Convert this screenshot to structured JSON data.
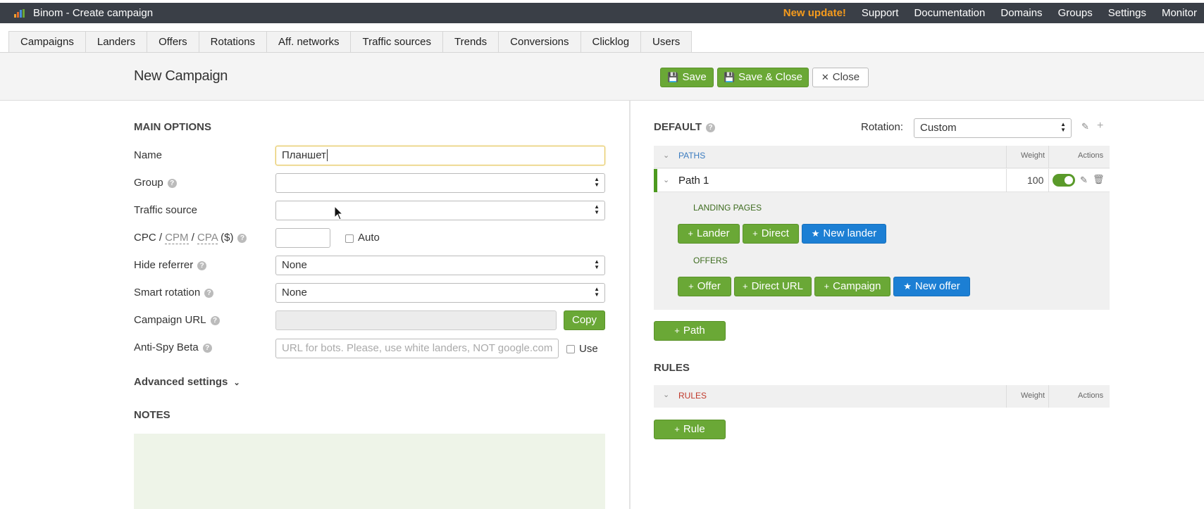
{
  "app": {
    "title": "Binom - Create campaign"
  },
  "topnav": {
    "update": "New update!",
    "items": [
      "Support",
      "Documentation",
      "Domains",
      "Groups",
      "Settings",
      "Monitor"
    ]
  },
  "tabs": [
    "Campaigns",
    "Landers",
    "Offers",
    "Rotations",
    "Aff. networks",
    "Traffic sources",
    "Trends",
    "Conversions",
    "Clicklog",
    "Users"
  ],
  "header": {
    "title": "New Campaign",
    "save": "Save",
    "save_close": "Save & Close",
    "close": "Close"
  },
  "main": {
    "section": "MAIN OPTIONS",
    "name_label": "Name",
    "name_value": "Планшет",
    "group_label": "Group",
    "traffic_label": "Traffic source",
    "cpc_label": {
      "cpc": "CPC",
      "sep1": "/",
      "cpm": "CPM",
      "sep2": "/",
      "cpa": "CPA",
      "unit": "($)"
    },
    "auto_label": "Auto",
    "hide_ref_label": "Hide referrer",
    "hide_ref_value": "None",
    "smart_rot_label": "Smart rotation",
    "smart_rot_value": "None",
    "campaign_url_label": "Campaign URL",
    "copy": "Copy",
    "antispy_label": "Anti-Spy Beta",
    "antispy_placeholder": "URL for bots. Please, use white landers, NOT google.com",
    "use_label": "Use",
    "advanced": "Advanced settings",
    "notes": "NOTES"
  },
  "right": {
    "default": "DEFAULT",
    "rotation_label": "Rotation:",
    "rotation_value": "Custom",
    "paths_header": "PATHS",
    "weight": "Weight",
    "actions": "Actions",
    "path_name": "Path 1",
    "path_weight": "100",
    "landing_pages": "LANDING PAGES",
    "add_lander": "Lander",
    "add_direct": "Direct",
    "new_lander": "New lander",
    "offers": "OFFERS",
    "add_offer": "Offer",
    "add_direct_url": "Direct URL",
    "add_campaign": "Campaign",
    "new_offer": "New offer",
    "add_path": "Path",
    "rules_title": "RULES",
    "rules_header": "RULES",
    "add_rule": "Rule"
  },
  "colors": {
    "green": "#6aa836",
    "blue": "#1c7fd4",
    "update": "#f59b1d",
    "topbar": "#3a3f47"
  }
}
